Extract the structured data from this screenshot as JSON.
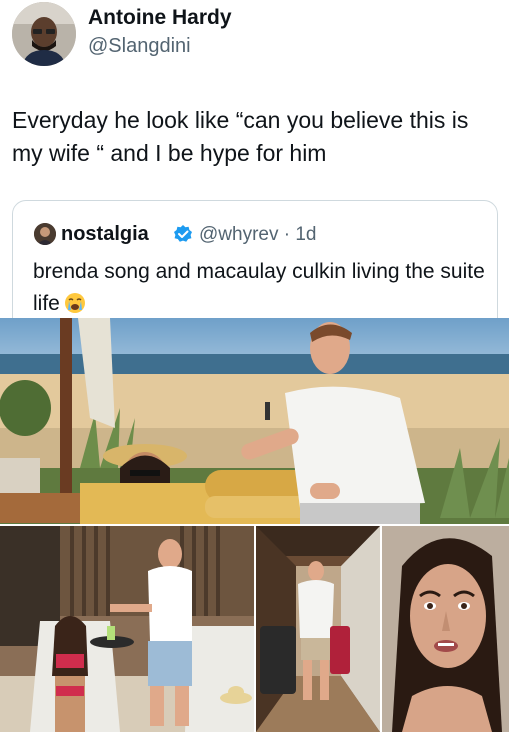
{
  "tweet": {
    "display_name": "Antoine Hardy",
    "handle": "@Slangdini",
    "text": "Everyday he look like “can you believe this is my wife “  and I be hype for him"
  },
  "quoted": {
    "name": "nostalgia",
    "handle_time": "@whyrev · 1d",
    "text": "brenda song and macaulay culkin living the suite life",
    "verified_color": "#1d9bf0"
  },
  "icons": [
    "avatar-icon",
    "verified-badge-icon",
    "crying-face-icon"
  ],
  "photos": [
    "beach-towel-photo",
    "pool-lounge-photo",
    "hotel-hallway-photo",
    "face-reaction-photo"
  ]
}
